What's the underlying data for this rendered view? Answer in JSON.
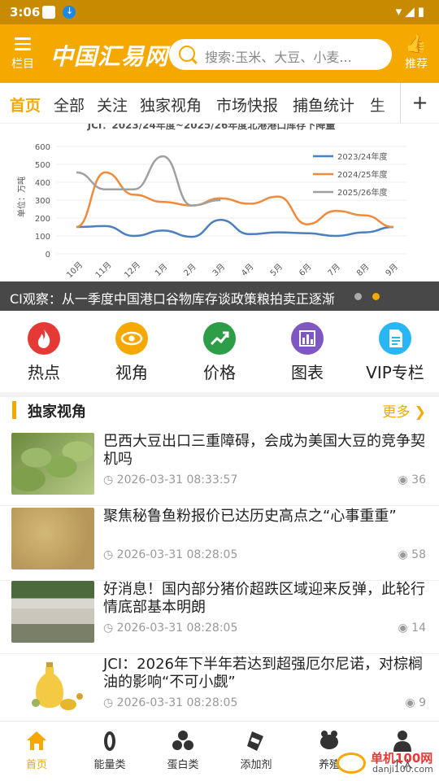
{
  "status_bar": {
    "time": "3:06"
  },
  "header": {
    "menu_label": "栏目",
    "logo": "中国汇易网",
    "search_placeholder": "搜索:玉米、大豆、小麦...",
    "recommend_label": "推荐"
  },
  "tabs": [
    "首页",
    "全部",
    "关注",
    "独家视角",
    "市场快报",
    "捕鱼统计",
    "生"
  ],
  "banner": {
    "caption": "CI观察：从一季度中国港口谷物库存谈政策粮拍卖正逐渐",
    "chart_data": {
      "type": "line",
      "title": "JCI：2023/24年度~2025/26年度北港港口库存下降量",
      "ylabel": "单位：万吨",
      "ylim": [
        0,
        600
      ],
      "yticks": [
        0,
        100,
        200,
        300,
        400,
        500,
        600
      ],
      "categories": [
        "10月",
        "11月",
        "12月",
        "1月",
        "2月",
        "3月",
        "4月",
        "5月",
        "6月",
        "7月",
        "8月",
        "9月"
      ],
      "series": [
        {
          "name": "2023/24年度",
          "color": "#4a7fc1",
          "values": [
            150,
            155,
            100,
            130,
            95,
            190,
            110,
            120,
            115,
            100,
            120,
            150
          ]
        },
        {
          "name": "2024/25年度",
          "color": "#f08a3c",
          "values": [
            150,
            455,
            330,
            290,
            270,
            310,
            280,
            320,
            165,
            240,
            215,
            150
          ]
        },
        {
          "name": "2025/26年度",
          "color": "#a0a0a0",
          "values": [
            455,
            360,
            360,
            545,
            270,
            300,
            null,
            null,
            null,
            null,
            null,
            null
          ]
        }
      ],
      "legend_position": "top-right"
    }
  },
  "quick_links": [
    {
      "label": "热点",
      "icon": "flame-icon",
      "color": "#e53935"
    },
    {
      "label": "视角",
      "icon": "eye-icon",
      "color": "#f5a800"
    },
    {
      "label": "价格",
      "icon": "trend-up-icon",
      "color": "#2e9d47"
    },
    {
      "label": "图表",
      "icon": "bar-chart-icon",
      "color": "#7e57c2"
    },
    {
      "label": "VIP专栏",
      "icon": "document-icon",
      "color": "#29b6f6"
    }
  ],
  "section": {
    "title": "独家视角",
    "more": "更多"
  },
  "articles": [
    {
      "title": "巴西大豆出口三重障碍，会成为美国大豆的竞争契机吗",
      "time": "2026-03-31 08:33:57",
      "views": "36",
      "thumb": "soybeans"
    },
    {
      "title": "聚焦秘鲁鱼粉报价已达历史高点之“心事重重”",
      "time": "2026-03-31 08:28:05",
      "views": "58",
      "thumb": "fishmeal"
    },
    {
      "title": "好消息！国内部分猪价超跌区域迎来反弹，此轮行情底部基本明朗",
      "time": "2026-03-31 08:28:05",
      "views": "14",
      "thumb": "pigs"
    },
    {
      "title": "JCI：2026年下半年若达到超强厄尔尼诺，对棕榈油的影响“不可小觑”",
      "time": "2026-03-31 08:28:05",
      "views": "9",
      "thumb": "oil"
    }
  ],
  "bottom_nav": [
    {
      "label": "首页",
      "icon": "home-icon",
      "active": true
    },
    {
      "label": "能量类",
      "icon": "grain-icon",
      "active": false
    },
    {
      "label": "蛋白类",
      "icon": "beans-icon",
      "active": false
    },
    {
      "label": "添加剂",
      "icon": "additive-icon",
      "active": false
    },
    {
      "label": "养殖",
      "icon": "livestock-icon",
      "active": false
    },
    {
      "label": "个人",
      "icon": "person-icon",
      "active": false
    }
  ],
  "watermark": {
    "text": "单机100网",
    "url": "danji100.com"
  }
}
